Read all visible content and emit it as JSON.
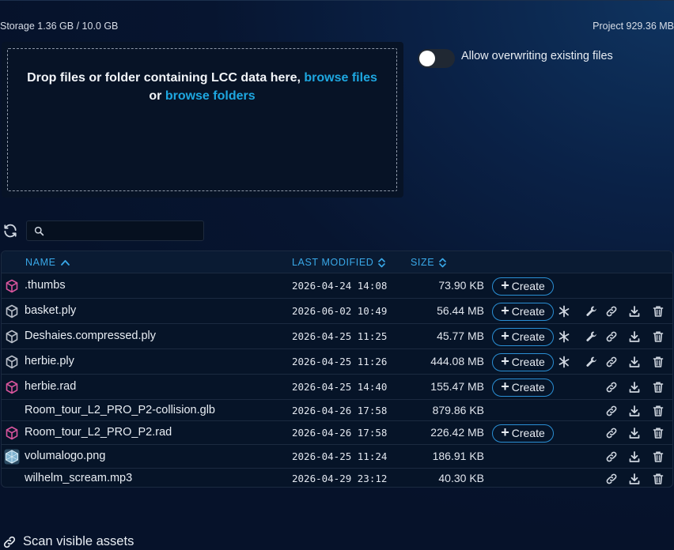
{
  "header": {
    "storage": "Storage 1.36 GB / 10.0 GB",
    "project": "Project 929.36 MB"
  },
  "dropzone": {
    "text_prefix": "Drop files or folder containing LCC data here, ",
    "browse_files": "browse files",
    "or": "or",
    "browse_folders": "browse folders"
  },
  "overwrite": {
    "label": "Allow overwriting existing files",
    "enabled": false
  },
  "search": {
    "placeholder": "",
    "value": ""
  },
  "table": {
    "columns": {
      "name": "NAME",
      "modified": "LAST MODIFIED",
      "size": "SIZE"
    },
    "create_label": "Create",
    "rows": [
      {
        "name": ".thumbs",
        "modified": "2026-04-24 14:08",
        "size": "73.90 KB",
        "icon": "box-pink-icon"
      },
      {
        "name": "basket.ply",
        "modified": "2026-06-02 10:49",
        "size": "56.44 MB",
        "icon": "box-gray-icon"
      },
      {
        "name": "Deshaies.compressed.ply",
        "modified": "2026-04-25 11:25",
        "size": "45.77 MB",
        "icon": "box-gray-icon"
      },
      {
        "name": "herbie.ply",
        "modified": "2026-04-25 11:26",
        "size": "444.08 MB",
        "icon": "box-gray-icon"
      },
      {
        "name": "herbie.rad",
        "modified": "2026-04-25 14:40",
        "size": "155.47 MB",
        "icon": "box-pink-icon"
      },
      {
        "name": "Room_tour_L2_PRO_P2-collision.glb",
        "modified": "2026-04-26 17:58",
        "size": "879.86 KB",
        "icon": ""
      },
      {
        "name": "Room_tour_L2_PRO_P2.rad",
        "modified": "2026-04-26 17:58",
        "size": "226.42 MB",
        "icon": "box-pink-icon"
      },
      {
        "name": "volumalogo.png",
        "modified": "2026-04-25 11:24",
        "size": "186.91 KB",
        "icon": "image-thumbnail-icon"
      },
      {
        "name": "wilhelm_scream.mp3",
        "modified": "2026-04-29 23:12",
        "size": "40.30 KB",
        "icon": ""
      }
    ]
  },
  "footer": {
    "scan": "Scan visible assets"
  },
  "colors": {
    "accent": "#1ea7e0",
    "header_text": "#39a8e8",
    "pink_icon": "#d9559d",
    "gray_icon": "#b8bec8"
  }
}
